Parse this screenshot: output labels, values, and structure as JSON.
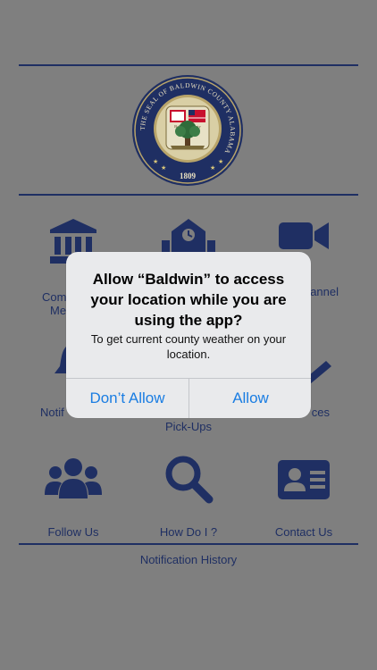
{
  "seal": {
    "ring_text": "THE SEAL OF BALDWIN COUNTY ALABAMA",
    "center_text": "Baldwin County",
    "year": "1809"
  },
  "grid": {
    "row1": [
      {
        "label": "Com",
        "label2": "Me",
        "icon": "courthouse-icon"
      },
      {
        "label": "",
        "icon": "school-icon"
      },
      {
        "label": "annel",
        "icon": "video-camera-icon"
      }
    ],
    "row2": [
      {
        "label": "Notif",
        "icon": "bell-icon"
      },
      {
        "label": "Pick-Ups",
        "icon": "truck-icon"
      },
      {
        "label": "ces",
        "icon": "wrench-icon"
      }
    ],
    "row3": [
      {
        "label": "Follow Us",
        "icon": "group-icon"
      },
      {
        "label": "How Do I ?",
        "icon": "search-icon"
      },
      {
        "label": "Contact Us",
        "icon": "contact-card-icon"
      }
    ]
  },
  "footer": {
    "history": "Notification History"
  },
  "dialog": {
    "title": "Allow “Baldwin” to access your location while you are using the app?",
    "message": "To get current county weather on your location.",
    "deny": "Don’t Allow",
    "allow": "Allow"
  },
  "colors": {
    "navy": "#1f2f63",
    "overlay_bg": "#7f7f7f",
    "dialog_bg": "#e9eaec",
    "ios_blue": "#1a7de2"
  }
}
